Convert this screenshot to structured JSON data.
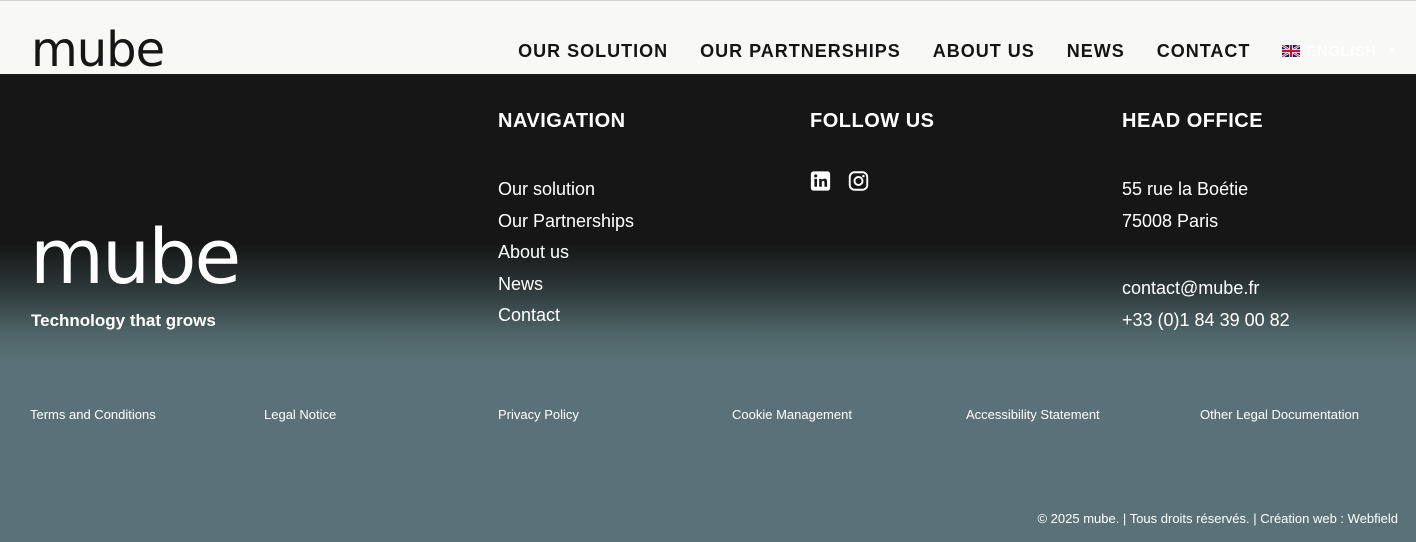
{
  "header": {
    "logo": "mube",
    "nav": [
      "OUR SOLUTION",
      "OUR PARTNERSHIPS",
      "ABOUT US",
      "NEWS",
      "CONTACT"
    ],
    "language": "ENGLISH",
    "flag_icon": "uk-flag-icon",
    "caret_icon": "chevron-down-icon"
  },
  "footer": {
    "logo": "mube",
    "tagline": "Technology that grows",
    "navigation": {
      "title": "NAVIGATION",
      "items": [
        "Our solution",
        "Our Partnerships",
        "About us",
        "News",
        "Contact"
      ]
    },
    "follow": {
      "title": "FOLLOW US",
      "icons": [
        "linkedin-icon",
        "instagram-icon"
      ]
    },
    "office": {
      "title": "HEAD OFFICE",
      "address_line1": "55 rue la Boétie",
      "address_line2": "75008 Paris",
      "email": "contact@mube.fr",
      "phone": "+33 (0)1 84 39 00 82"
    },
    "legal": [
      "Terms and Conditions",
      "Legal Notice",
      "Privacy Policy",
      "Cookie Management",
      "Accessibility Statement",
      "Other Legal Documentation"
    ],
    "copyright": "© 2025 mube. | Tous droits réservés. | Création web : Webfield"
  },
  "colors": {
    "header_bg": "#f8f8f6",
    "footer_dark": "#161616",
    "footer_teal": "#5a7277"
  }
}
